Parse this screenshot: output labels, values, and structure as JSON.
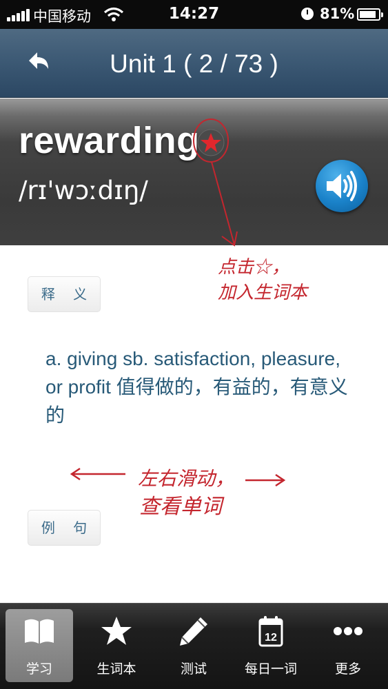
{
  "status_bar": {
    "carrier": "中国移动",
    "time": "14:27",
    "battery": "81%"
  },
  "nav": {
    "title": "Unit 1 ( 2 / 73 )",
    "back_icon": "back-arrow-icon"
  },
  "word": {
    "text": "rewarding",
    "phonetic": "/rɪ'wɔːdɪŋ/",
    "favorite_icon": "star-icon",
    "speaker_icon": "speaker-icon"
  },
  "sections": {
    "definition_label": "释 义",
    "example_label": "例 句"
  },
  "definition": {
    "text": "a. giving sb. satisfaction, pleasure, or profit 值得做的，有益的，有意义的"
  },
  "annotations": {
    "favorite_hint_line1": "点击☆，",
    "favorite_hint_line2": "加入生词本",
    "swipe_hint_line1": "左右滑动，",
    "swipe_hint_line2": "查看单词"
  },
  "tabs": [
    {
      "label": "学习",
      "icon": "book-icon",
      "active": true
    },
    {
      "label": "生词本",
      "icon": "star-icon",
      "active": false
    },
    {
      "label": "测试",
      "icon": "pencil-icon",
      "active": false
    },
    {
      "label": "每日一词",
      "icon": "calendar-icon",
      "active": false,
      "badge": "12"
    },
    {
      "label": "更多",
      "icon": "more-icon",
      "active": false
    }
  ],
  "colors": {
    "accent_red": "#c4262e",
    "definition_text": "#285a78",
    "navbar": "#3d5a75",
    "speaker": "#1a82c9"
  }
}
